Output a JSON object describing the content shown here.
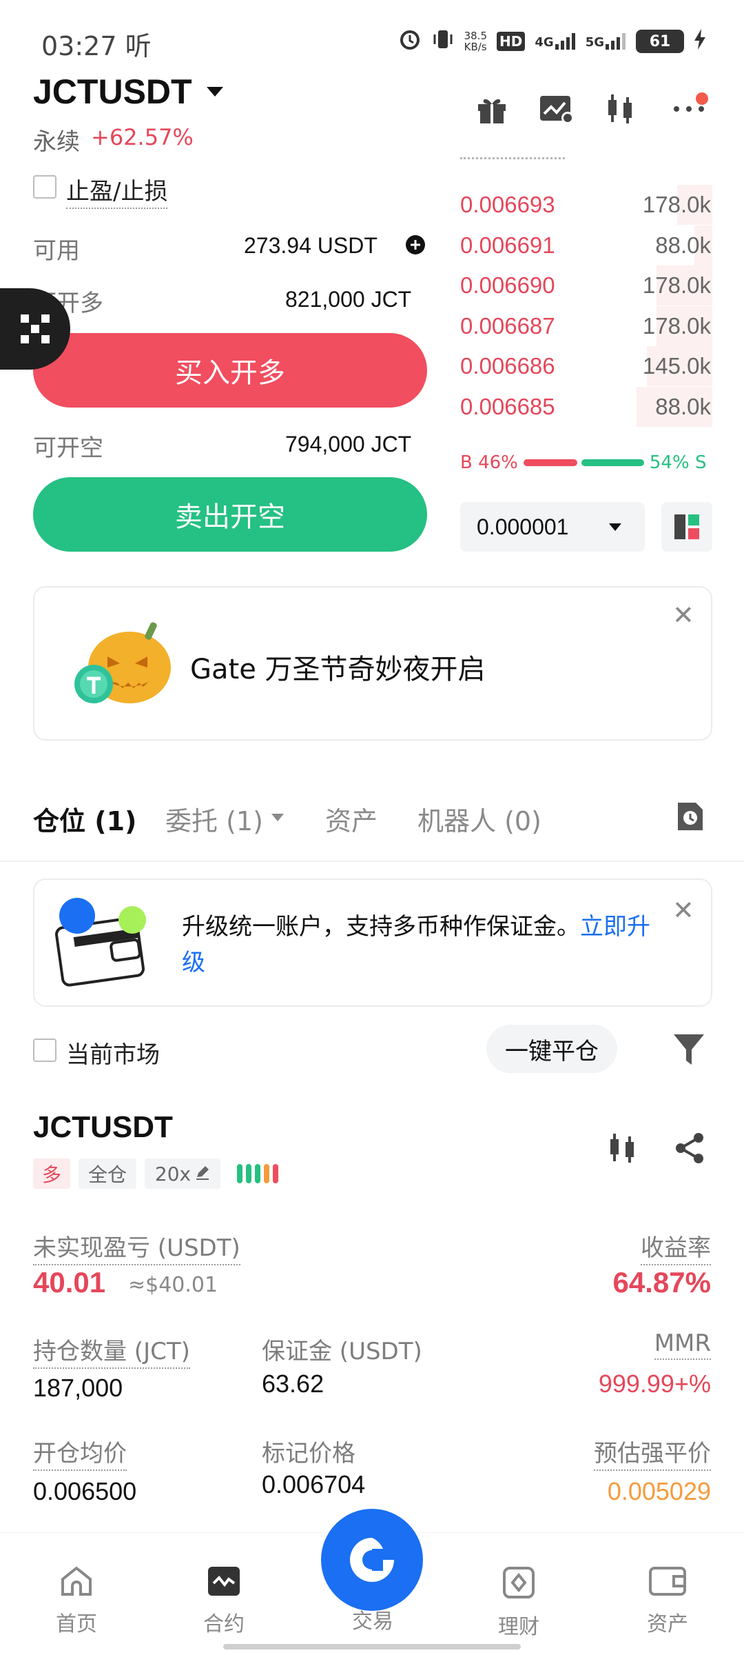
{
  "status_bar": {
    "time": "03:27 听",
    "net_speed_top": "38.5",
    "net_speed_bottom": "KB/s",
    "hd": "HD",
    "g4": "4G",
    "g5": "5G",
    "battery": "61"
  },
  "header": {
    "pair": "JCTUSDT",
    "type": "永续",
    "change": "+62.57%"
  },
  "form": {
    "tpsl_label": "止盈/止损",
    "available_label": "可用",
    "available_value": "273.94 USDT",
    "open_long_label": "可开多",
    "open_long_value": "821,000 JCT",
    "buy_button": "买入开多",
    "open_short_label": "可开空",
    "open_short_value": "794,000 JCT",
    "sell_button": "卖出开空"
  },
  "order_book": {
    "asks": [
      {
        "price": "0.006693",
        "qty": "178.0k",
        "depth": 0.14
      },
      {
        "price": "0.006691",
        "qty": "88.0k",
        "depth": 0.07
      },
      {
        "price": "0.006690",
        "qty": "178.0k",
        "depth": 0.22
      },
      {
        "price": "0.006687",
        "qty": "178.0k",
        "depth": 0.22
      },
      {
        "price": "0.006686",
        "qty": "145.0k",
        "depth": 0.26
      },
      {
        "price": "0.006685",
        "qty": "88.0k",
        "depth": 0.3
      }
    ],
    "buy_ratio_label": "B 46%",
    "sell_ratio_label": "54% S",
    "buy_ratio": 0.46,
    "tick_size": "0.000001"
  },
  "promo": {
    "text": "Gate 万圣节奇妙夜开启"
  },
  "tabs": [
    {
      "label": "仓位 (1)"
    },
    {
      "label": "委托 (1)"
    },
    {
      "label": "资产"
    },
    {
      "label": "机器人 (0)"
    }
  ],
  "upgrade": {
    "text": "升级统一账户，支持多币种作保证金。",
    "link": "立即升级"
  },
  "filter": {
    "current_market": "当前市场",
    "close_all": "一键平仓"
  },
  "position": {
    "pair": "JCTUSDT",
    "side": "多",
    "margin_mode": "全仓",
    "leverage": "20x",
    "unrealized_label": "未实现盈亏 (USDT)",
    "unrealized_value": "40.01",
    "unrealized_usd": "≈$40.01",
    "roe_label": "收益率",
    "roe_value": "64.87%",
    "size_label": "持仓数量 (JCT)",
    "size_value": "187,000",
    "margin_label": "保证金 (USDT)",
    "margin_value": "63.62",
    "mmr_label": "MMR",
    "mmr_value": "999.99+%",
    "entry_label": "开仓均价",
    "entry_value": "0.006500",
    "mark_label": "标记价格",
    "mark_value": "0.006704",
    "liq_label": "预估强平价",
    "liq_value": "0.005029"
  },
  "nav": [
    {
      "label": "首页"
    },
    {
      "label": "合约"
    },
    {
      "label": "交易"
    },
    {
      "label": "理财"
    },
    {
      "label": "资产"
    }
  ],
  "colors": {
    "red": "#e5475a",
    "green": "#25c083",
    "blue": "#1b6ff2",
    "orange": "#f59b3d"
  }
}
